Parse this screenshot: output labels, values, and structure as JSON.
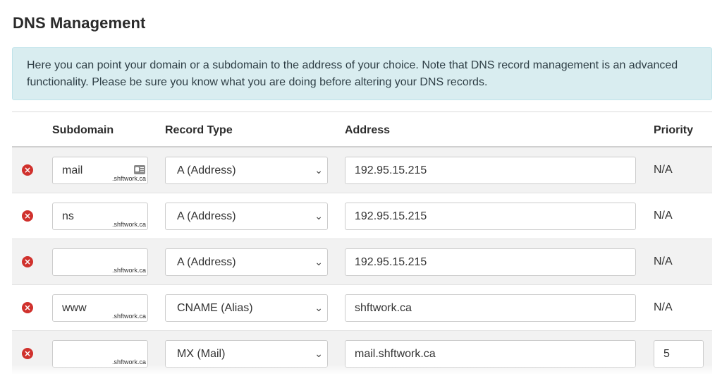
{
  "page": {
    "title": "DNS Management",
    "notice": "Here you can point your domain or a subdomain to the address of your choice. Note that DNS record management is an advanced functionality. Please be sure you know what you are doing before altering your DNS records."
  },
  "table": {
    "headers": {
      "subdomain": "Subdomain",
      "record_type": "Record Type",
      "address": "Address",
      "priority": "Priority"
    },
    "domain_suffix": ".shftwork.ca",
    "rows": [
      {
        "subdomain": "mail",
        "record_type": "A (Address)",
        "address": "192.95.15.215",
        "priority": "N/A"
      },
      {
        "subdomain": "ns",
        "record_type": "A (Address)",
        "address": "192.95.15.215",
        "priority": "N/A"
      },
      {
        "subdomain": "",
        "record_type": "A (Address)",
        "address": "192.95.15.215",
        "priority": "N/A"
      },
      {
        "subdomain": "www",
        "record_type": "CNAME (Alias)",
        "address": "shftwork.ca",
        "priority": "N/A"
      },
      {
        "subdomain": "",
        "record_type": "MX (Mail)",
        "address": "mail.shftwork.ca",
        "priority": "5"
      }
    ]
  },
  "icons": {
    "delete": "remove-circle-icon",
    "contact_card": "contact-card-icon",
    "select_arrow": "chevron-down-icon"
  },
  "colors": {
    "delete_red": "#d0312d",
    "info_background": "#d9edf0",
    "row_stripe": "#f2f2f2"
  }
}
